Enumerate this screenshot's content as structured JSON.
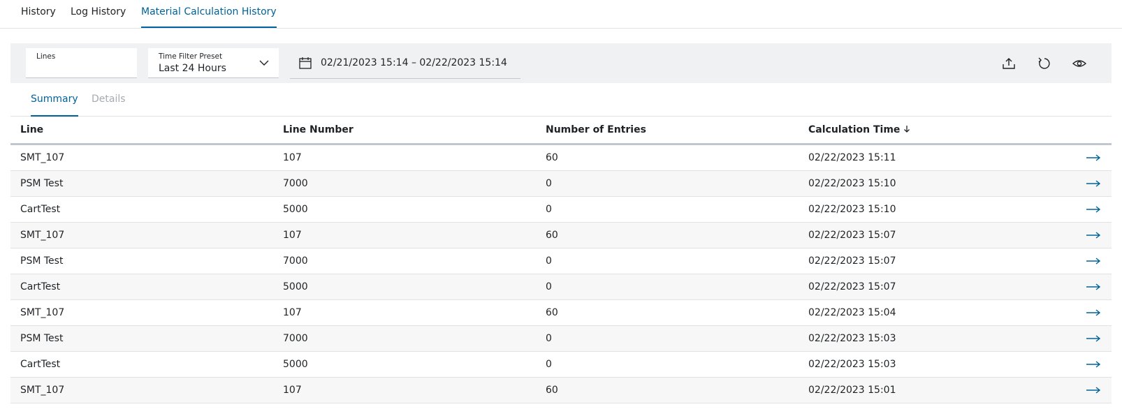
{
  "top_tabs": [
    {
      "label": "History"
    },
    {
      "label": "Log History"
    },
    {
      "label": "Material Calculation History",
      "active": true
    }
  ],
  "filters": {
    "lines_label": "Lines",
    "preset_label": "Time Filter Preset",
    "preset_value": "Last 24 Hours",
    "date_range": "02/21/2023 15:14 – 02/22/2023 15:14"
  },
  "toolbar": {
    "export_icon": "upload-icon",
    "reset_icon": "refresh-icon",
    "view_icon": "eye-icon"
  },
  "sub_tabs": [
    {
      "label": "Summary",
      "active": true
    },
    {
      "label": "Details",
      "disabled": true
    }
  ],
  "table": {
    "headers": [
      "Line",
      "Line Number",
      "Number of Entries",
      "Calculation Time"
    ],
    "sort_column": "Calculation Time",
    "sort_direction": "descending",
    "rows": [
      {
        "line": "SMT_107",
        "line_number": "107",
        "entries": "60",
        "time": "02/22/2023 15:11"
      },
      {
        "line": "PSM Test",
        "line_number": "7000",
        "entries": "0",
        "time": "02/22/2023 15:10"
      },
      {
        "line": "CartTest",
        "line_number": "5000",
        "entries": "0",
        "time": "02/22/2023 15:10"
      },
      {
        "line": "SMT_107",
        "line_number": "107",
        "entries": "60",
        "time": "02/22/2023 15:07"
      },
      {
        "line": "PSM Test",
        "line_number": "7000",
        "entries": "0",
        "time": "02/22/2023 15:07"
      },
      {
        "line": "CartTest",
        "line_number": "5000",
        "entries": "0",
        "time": "02/22/2023 15:07"
      },
      {
        "line": "SMT_107",
        "line_number": "107",
        "entries": "60",
        "time": "02/22/2023 15:04"
      },
      {
        "line": "PSM Test",
        "line_number": "7000",
        "entries": "0",
        "time": "02/22/2023 15:03"
      },
      {
        "line": "CartTest",
        "line_number": "5000",
        "entries": "0",
        "time": "02/22/2023 15:03"
      },
      {
        "line": "SMT_107",
        "line_number": "107",
        "entries": "60",
        "time": "02/22/2023 15:01"
      }
    ]
  },
  "colors": {
    "accent": "#00629a",
    "filter_bar_bg": "#eff1f2",
    "stripe": "#f7f7f7"
  }
}
